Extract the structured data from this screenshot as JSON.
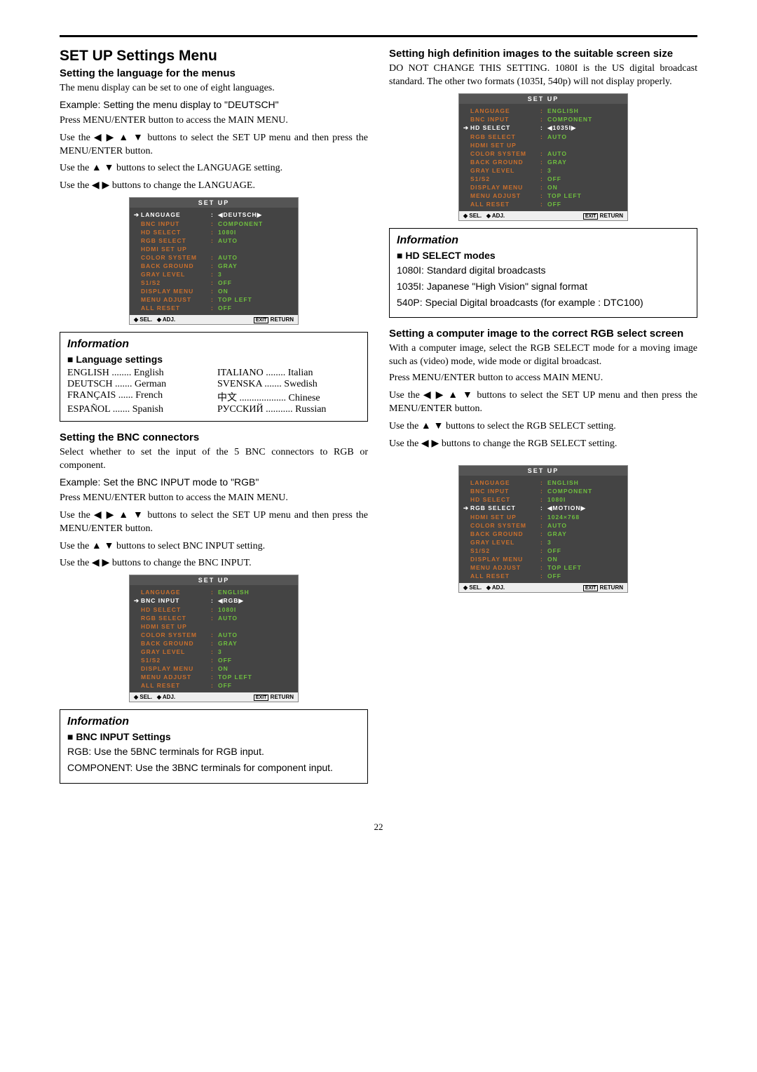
{
  "mainTitle": "SET UP Settings Menu",
  "pageNum": "22",
  "left": {
    "s1": {
      "h": "Setting the language for the menus",
      "p1": "The menu display can be set to one of eight languages.",
      "p2": "Example: Setting the menu display to \"DEUTSCH\"",
      "p3": "Press MENU/ENTER button to access the MAIN MENU.",
      "p4a": "Use the ",
      "p4b": " buttons to select the SET UP menu and then press the MENU/ENTER button.",
      "p5a": "Use the ",
      "p5b": " buttons to select the LANGUAGE setting.",
      "p6a": "Use the ",
      "p6b": " buttons to change the LANGUAGE."
    },
    "info1": {
      "title": "Information",
      "sub": "Language settings",
      "rows": [
        [
          "ENGLISH ........ English",
          "ITALIANO ........ Italian"
        ],
        [
          "DEUTSCH ....... German",
          "SVENSKA ....... Swedish"
        ],
        [
          "FRANÇAIS ...... French",
          "中文 ................... Chinese"
        ],
        [
          "ESPAÑOL ....... Spanish",
          "РУССКИЙ ........... Russian"
        ]
      ]
    },
    "s2": {
      "h": "Setting the BNC connectors",
      "p1": "Select whether to set the input of the 5 BNC connectors to RGB or component.",
      "p2": "Example: Set the BNC INPUT mode to \"RGB\"",
      "p3": "Press MENU/ENTER button to access the MAIN MENU.",
      "p4a": "Use the ",
      "p4b": " buttons to select the SET UP menu and then press the MENU/ENTER button.",
      "p5a": "Use the ",
      "p5b": " buttons to select BNC INPUT setting.",
      "p6a": "Use the ",
      "p6b": " buttons to change the BNC INPUT."
    },
    "info2": {
      "title": "Information",
      "sub": "BNC INPUT Settings",
      "p1": "RGB: Use the 5BNC terminals for RGB input.",
      "p2": "COMPONENT: Use the 3BNC terminals for component input."
    }
  },
  "right": {
    "s1": {
      "h": "Setting high definition images to the suitable screen size",
      "p1": "DO NOT CHANGE THIS SETTING. 1080I is the US digital broadcast standard. The other two formats (1035I, 540p) will not display properly."
    },
    "info1": {
      "title": "Information",
      "sub": "HD SELECT modes",
      "p1": "1080I: Standard digital broadcasts",
      "p2": "1035I: Japanese \"High Vision\" signal format",
      "p3": "540P: Special Digital broadcasts (for example : DTC100)"
    },
    "s2": {
      "h": "Setting a computer image to the correct RGB select screen",
      "p1": "With a computer image, select the RGB SELECT mode for a moving image such as (video) mode, wide mode or digital broadcast.",
      "p2": "Press MENU/ENTER button to access MAIN MENU.",
      "p3a": "Use the ",
      "p3b": " buttons to select the SET UP menu and then press the MENU/ENTER button.",
      "p4a": "Use the ",
      "p4b": " buttons to select the RGB SELECT setting.",
      "p5a": "Use the ",
      "p5b": " buttons to change the RGB SELECT setting."
    }
  },
  "osd": {
    "title": "SET UP",
    "foot": {
      "sel": "SEL.",
      "adj": "ADJ.",
      "exit": "EXIT",
      "ret": "RETURN"
    },
    "menu1": [
      {
        "l": "LANGUAGE",
        "v": "◀DEUTSCH▶",
        "sel": true
      },
      {
        "l": "BNC INPUT",
        "v": "COMPONENT"
      },
      {
        "l": "HD SELECT",
        "v": "1080I"
      },
      {
        "l": "RGB SELECT",
        "v": "AUTO"
      },
      {
        "l": "HDMI SET UP",
        "v": ""
      },
      {
        "l": "COLOR SYSTEM",
        "v": "AUTO"
      },
      {
        "l": "BACK GROUND",
        "v": "GRAY"
      },
      {
        "l": "GRAY LEVEL",
        "v": "3"
      },
      {
        "l": "S1/S2",
        "v": "OFF"
      },
      {
        "l": "DISPLAY MENU",
        "v": "ON"
      },
      {
        "l": "MENU ADJUST",
        "v": "TOP LEFT"
      },
      {
        "l": "ALL RESET",
        "v": "OFF"
      }
    ],
    "menu2": [
      {
        "l": "LANGUAGE",
        "v": "ENGLISH"
      },
      {
        "l": "BNC INPUT",
        "v": "◀RGB▶",
        "sel": true
      },
      {
        "l": "HD SELECT",
        "v": "1080I"
      },
      {
        "l": "RGB SELECT",
        "v": "AUTO"
      },
      {
        "l": "HDMI SET UP",
        "v": ""
      },
      {
        "l": "COLOR SYSTEM",
        "v": "AUTO"
      },
      {
        "l": "BACK GROUND",
        "v": "GRAY"
      },
      {
        "l": "GRAY LEVEL",
        "v": "3"
      },
      {
        "l": "S1/S2",
        "v": "OFF"
      },
      {
        "l": "DISPLAY MENU",
        "v": "ON"
      },
      {
        "l": "MENU ADJUST",
        "v": "TOP LEFT"
      },
      {
        "l": "ALL RESET",
        "v": "OFF"
      }
    ],
    "menu3": [
      {
        "l": "LANGUAGE",
        "v": "ENGLISH"
      },
      {
        "l": "BNC INPUT",
        "v": "COMPONENT"
      },
      {
        "l": "HD SELECT",
        "v": "◀1035I▶",
        "sel": true
      },
      {
        "l": "RGB SELECT",
        "v": "AUTO"
      },
      {
        "l": "HDMI SET UP",
        "v": ""
      },
      {
        "l": "COLOR SYSTEM",
        "v": "AUTO"
      },
      {
        "l": "BACK GROUND",
        "v": "GRAY"
      },
      {
        "l": "GRAY LEVEL",
        "v": "3"
      },
      {
        "l": "S1/S2",
        "v": "OFF"
      },
      {
        "l": "DISPLAY MENU",
        "v": "ON"
      },
      {
        "l": "MENU ADJUST",
        "v": "TOP LEFT"
      },
      {
        "l": "ALL RESET",
        "v": "OFF"
      }
    ],
    "menu4": [
      {
        "l": "LANGUAGE",
        "v": "ENGLISH"
      },
      {
        "l": "BNC INPUT",
        "v": "COMPONENT"
      },
      {
        "l": "HD SELECT",
        "v": "1080I"
      },
      {
        "l": "RGB SELECT",
        "v": "◀MOTION▶",
        "sel": true
      },
      {
        "l": "HDMI SET UP",
        "v": "1024×768"
      },
      {
        "l": "COLOR SYSTEM",
        "v": "AUTO"
      },
      {
        "l": "BACK GROUND",
        "v": "GRAY"
      },
      {
        "l": "GRAY LEVEL",
        "v": "3"
      },
      {
        "l": "S1/S2",
        "v": "OFF"
      },
      {
        "l": "DISPLAY MENU",
        "v": "ON"
      },
      {
        "l": "MENU ADJUST",
        "v": "TOP LEFT"
      },
      {
        "l": "ALL RESET",
        "v": "OFF"
      }
    ]
  },
  "arrows": {
    "all": "◀ ▶ ▲ ▼",
    "ud": "▲ ▼",
    "lr": "◀ ▶"
  }
}
